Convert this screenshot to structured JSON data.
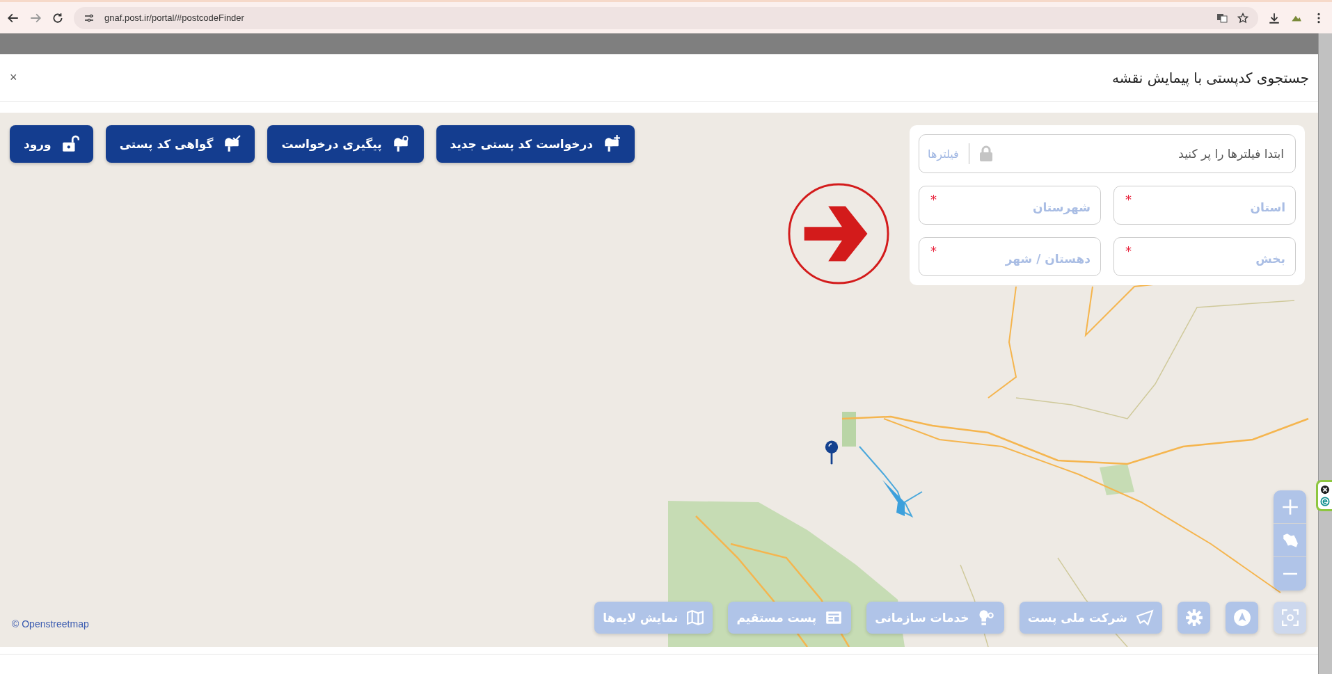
{
  "browser": {
    "url": "gnaf.post.ir/portal/#postcodeFinder"
  },
  "modal": {
    "title": "جستجوی کدپستی با پیمایش نقشه",
    "close": "×"
  },
  "action_buttons": [
    {
      "kind": "new",
      "label": "درخواست کد پستی جدید"
    },
    {
      "kind": "track",
      "label": "پیگیری درخواست"
    },
    {
      "kind": "certificate",
      "label": "گواهی کد پستی"
    },
    {
      "kind": "login",
      "label": "ورود"
    }
  ],
  "filter_panel": {
    "search": {
      "placeholder": "ابتدا فیلترها را پر کنید",
      "locked": true
    },
    "filters_label": "فیلترها",
    "fields": [
      {
        "label": "استان",
        "required_mark": "*"
      },
      {
        "label": "شهرستان",
        "required_mark": "*"
      },
      {
        "label": "بخش",
        "required_mark": "*"
      },
      {
        "label": "دهستان / شهر",
        "required_mark": "*"
      }
    ]
  },
  "map_tools": [
    {
      "kind": "fit-view",
      "disabled": true
    },
    {
      "kind": "navigate",
      "disabled": false
    },
    {
      "kind": "settings",
      "disabled": false
    }
  ],
  "layer_buttons": [
    {
      "kind": "company",
      "label": "شرکت ملی پست"
    },
    {
      "kind": "services",
      "label": "خدمات سازمانی"
    },
    {
      "kind": "direct",
      "label": "پست مستقیم"
    },
    {
      "kind": "layers",
      "label": "نمایش لایه‌ها"
    }
  ],
  "attribution": "© Openstreetmap"
}
